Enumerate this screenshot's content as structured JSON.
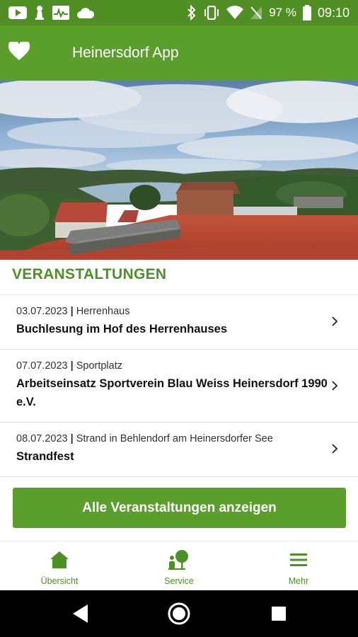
{
  "status_bar": {
    "battery_percent": "97 %",
    "time": "09:10",
    "left_icons": [
      "youtube-icon",
      "chess-pawn-icon",
      "activity-monitor-icon",
      "cloud-icon"
    ],
    "right_icons": [
      "bluetooth-icon",
      "vibrate-icon",
      "wifi-icon",
      "no-sim-icon",
      "battery-icon"
    ]
  },
  "app_bar": {
    "title": "Heinersdorf App",
    "favorite_icon": "heart-icon"
  },
  "hero": {
    "image": "lake-landscape-photo"
  },
  "events_section": {
    "title": "VERANSTALTUNGEN",
    "items": [
      {
        "date": "03.07.2023",
        "location": "Herrenhaus",
        "name": "Buchlesung im Hof des Herrenhauses"
      },
      {
        "date": "07.07.2023",
        "location": "Sportplatz",
        "name": "Arbeitseinsatz Sportverein Blau Weiss Heinersdorf 1990 e.V."
      },
      {
        "date": "08.07.2023",
        "location": "Strand in Behlendorf am Heinersdorfer See",
        "name": "Strandfest"
      }
    ],
    "separator": "|",
    "show_all_label": "Alle Veranstaltungen anzeigen"
  },
  "bottom_nav": {
    "items": [
      {
        "label": "Übersicht",
        "icon": "home-icon"
      },
      {
        "label": "Service",
        "icon": "service-icon"
      },
      {
        "label": "Mehr",
        "icon": "menu-icon"
      }
    ]
  },
  "colors": {
    "primary": "#5a9f2c",
    "status_bar": "#4f8f23",
    "accent_text": "#4d9124"
  }
}
